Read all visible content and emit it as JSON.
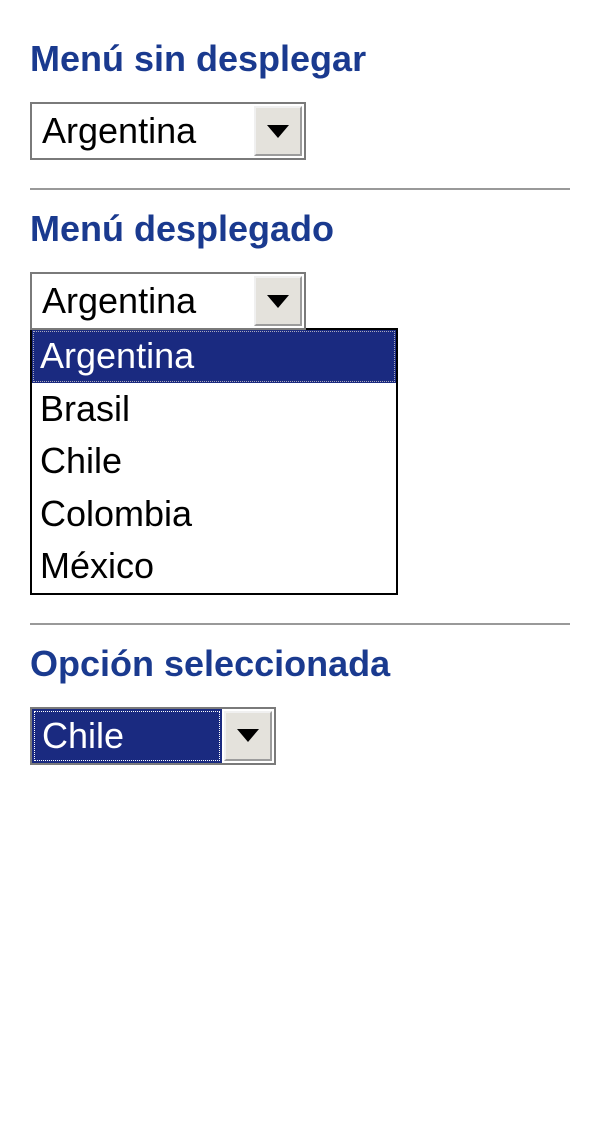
{
  "section1": {
    "heading": "Menú sin desplegar",
    "selected": "Argentina"
  },
  "section2": {
    "heading": "Menú desplegado",
    "selected": "Argentina",
    "options": [
      "Argentina",
      "Brasil",
      "Chile",
      "Colombia",
      "México"
    ]
  },
  "section3": {
    "heading": "Opción seleccionada",
    "selected": "Chile"
  }
}
